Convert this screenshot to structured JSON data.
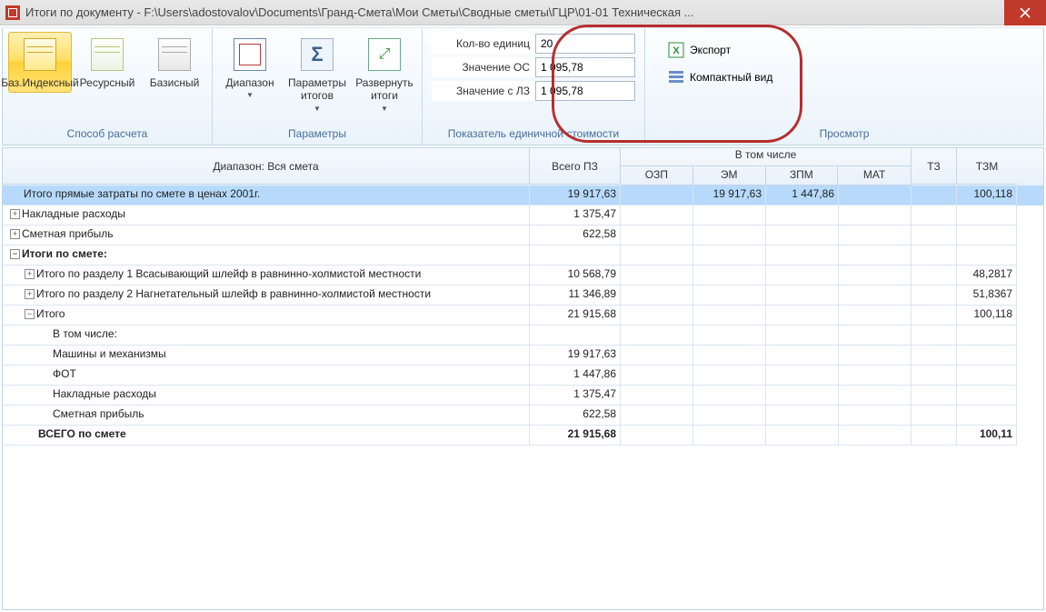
{
  "title": "Итоги по документу - F:\\Users\\adostovalov\\Documents\\Гранд-Смета\\Мои Сметы\\Сводные сметы\\ГЦР\\01-01 Техническая ...",
  "ribbon": {
    "groups": {
      "calc": {
        "label": "Способ расчета",
        "baseIndex": "Баз.Индексный",
        "resource": "Ресурсный",
        "basic": "Базисный"
      },
      "params": {
        "label": "Параметры",
        "range": "Диапазон",
        "paramTotals": "Параметры итогов",
        "expandTotals": "Развернуть итоги"
      },
      "unitCost": {
        "label": "Показатель единичной стоимости",
        "unitsLabel": "Кол-во единиц",
        "unitsValue": "20",
        "osLabel": "Значение ОС",
        "osValue": "1 095,78",
        "lzLabel": "Значение с ЛЗ",
        "lzValue": "1 095,78"
      },
      "view": {
        "label": "Просмотр",
        "export": "Экспорт",
        "compact": "Компактный вид"
      }
    }
  },
  "grid": {
    "rangeHeader": "Диапазон: Вся смета",
    "cols": {
      "pz": "Всего ПЗ",
      "group": "В том числе",
      "ozp": "ОЗП",
      "em": "ЭМ",
      "zpm": "ЗПМ",
      "mat": "МАТ",
      "tz": "ТЗ",
      "tzm": "ТЗМ"
    },
    "rows": [
      {
        "indent": 0,
        "exp": "",
        "sel": true,
        "bold": false,
        "text": "Итого прямые затраты по смете в ценах 2001г.",
        "pz": "19 917,63",
        "ozp": "",
        "em": "19 917,63",
        "zpm": "1 447,86",
        "mat": "",
        "tz": "",
        "tzm": "100,118"
      },
      {
        "indent": 0,
        "exp": "+",
        "sel": false,
        "bold": false,
        "text": "Накладные расходы",
        "pz": "1 375,47",
        "ozp": "",
        "em": "",
        "zpm": "",
        "mat": "",
        "tz": "",
        "tzm": ""
      },
      {
        "indent": 0,
        "exp": "+",
        "sel": false,
        "bold": false,
        "text": "Сметная прибыль",
        "pz": "622,58",
        "ozp": "",
        "em": "",
        "zpm": "",
        "mat": "",
        "tz": "",
        "tzm": ""
      },
      {
        "indent": 0,
        "exp": "-",
        "sel": false,
        "bold": true,
        "text": "Итоги по смете:",
        "pz": "",
        "ozp": "",
        "em": "",
        "zpm": "",
        "mat": "",
        "tz": "",
        "tzm": ""
      },
      {
        "indent": 1,
        "exp": "+",
        "sel": false,
        "bold": false,
        "text": "Итого по разделу 1 Всасывающий шлейф в равнинно-холмистой местности",
        "pz": "10 568,79",
        "ozp": "",
        "em": "",
        "zpm": "",
        "mat": "",
        "tz": "",
        "tzm": "48,2817"
      },
      {
        "indent": 1,
        "exp": "+",
        "sel": false,
        "bold": false,
        "text": "Итого по разделу 2 Нагнетательный шлейф в равнинно-холмистой местности",
        "pz": "11 346,89",
        "ozp": "",
        "em": "",
        "zpm": "",
        "mat": "",
        "tz": "",
        "tzm": "51,8367"
      },
      {
        "indent": 1,
        "exp": "-",
        "sel": false,
        "bold": false,
        "text": "Итого",
        "pz": "21 915,68",
        "ozp": "",
        "em": "",
        "zpm": "",
        "mat": "",
        "tz": "",
        "tzm": "100,118"
      },
      {
        "indent": 2,
        "exp": "",
        "sel": false,
        "bold": false,
        "text": "В том числе:",
        "pz": "",
        "ozp": "",
        "em": "",
        "zpm": "",
        "mat": "",
        "tz": "",
        "tzm": ""
      },
      {
        "indent": 2,
        "exp": "",
        "sel": false,
        "bold": false,
        "text": "Машины и механизмы",
        "pz": "19 917,63",
        "ozp": "",
        "em": "",
        "zpm": "",
        "mat": "",
        "tz": "",
        "tzm": ""
      },
      {
        "indent": 2,
        "exp": "",
        "sel": false,
        "bold": false,
        "text": "ФОТ",
        "pz": "1 447,86",
        "ozp": "",
        "em": "",
        "zpm": "",
        "mat": "",
        "tz": "",
        "tzm": ""
      },
      {
        "indent": 2,
        "exp": "",
        "sel": false,
        "bold": false,
        "text": "Накладные расходы",
        "pz": "1 375,47",
        "ozp": "",
        "em": "",
        "zpm": "",
        "mat": "",
        "tz": "",
        "tzm": ""
      },
      {
        "indent": 2,
        "exp": "",
        "sel": false,
        "bold": false,
        "text": "Сметная прибыль",
        "pz": "622,58",
        "ozp": "",
        "em": "",
        "zpm": "",
        "mat": "",
        "tz": "",
        "tzm": ""
      },
      {
        "indent": 1,
        "exp": "",
        "sel": false,
        "bold": true,
        "text": "ВСЕГО по смете",
        "pz": "21 915,68",
        "ozp": "",
        "em": "",
        "zpm": "",
        "mat": "",
        "tz": "",
        "tzm": "100,11"
      }
    ]
  }
}
